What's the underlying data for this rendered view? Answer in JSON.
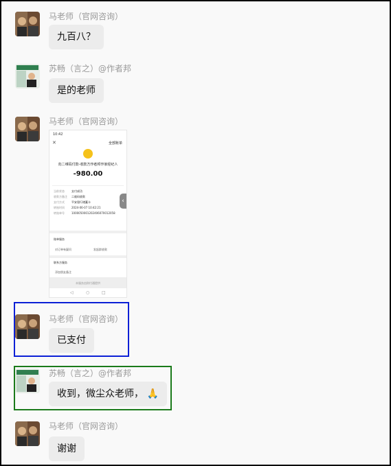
{
  "chat": {
    "messages": [
      {
        "sender": "马老师（官网咨询）",
        "text": "九百八？"
      },
      {
        "sender": "苏畅（言之）@作者邦",
        "text": "是的老师"
      },
      {
        "sender": "马老师（官网咨询）",
        "type": "image"
      },
      {
        "sender": "马老师（官网咨询）",
        "text": "已支付"
      },
      {
        "sender": "苏畅（言之）@作者邦",
        "text": "收到，微尘众老师，",
        "emoji": "🙏"
      },
      {
        "sender": "马老师（官网咨询）",
        "text": "谢谢"
      }
    ]
  },
  "payment_screenshot": {
    "status_time": "10:42",
    "top_right": "全部账单",
    "merchant": "向二维码付款-收款方作者邦作家经纪人",
    "amount": "-980.00",
    "rows": [
      {
        "label": "当前状态",
        "value": "支付成功"
      },
      {
        "label": "收款方备注",
        "value": "二维码收款"
      },
      {
        "label": "支付方式",
        "value": "平安银行储蓄卡"
      },
      {
        "label": "转账时间",
        "value": "2024-06-07 10:42:21"
      },
      {
        "label": "转账单号",
        "value": "1000050001202406070012058"
      }
    ],
    "section_1": "账单服务",
    "option_1": "对订单有疑问",
    "option_2": "发起群收款",
    "section_2": "联系方服务",
    "option_3": "添加朋友备注",
    "footer": "本服务由财付通提供"
  }
}
